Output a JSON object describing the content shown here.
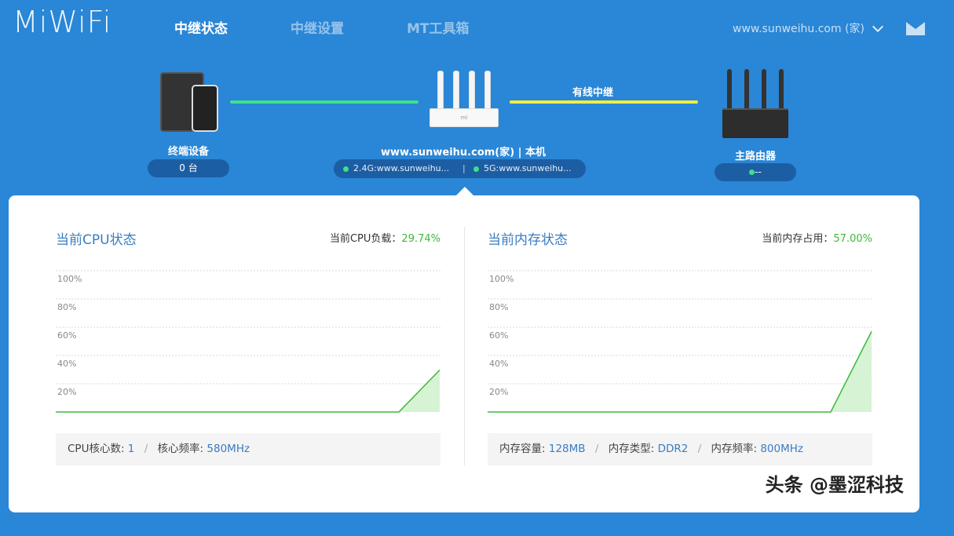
{
  "header": {
    "logo": "MiWiFi",
    "nav": [
      {
        "label": "中继状态",
        "active": true
      },
      {
        "label": "中继设置",
        "active": false
      },
      {
        "label": "MT工具箱",
        "active": false
      }
    ],
    "account": "www.sunweihu.com (家)"
  },
  "topology": {
    "devices_label": "终端设备",
    "devices_count": "0 台",
    "wired_label": "有线中继",
    "router_name": "www.sunweihu.com(家) | 本机",
    "ssid_24": "2.4G:www.sunweihu...",
    "ssid_5": "5G:www.sunweihu...",
    "ssid_sep": "|",
    "main_router_label": "主路由器",
    "main_router_status": "--",
    "router_mark": "mi"
  },
  "cpu": {
    "title": "当前CPU状态",
    "metric_label": "当前CPU负载：",
    "metric_value": "29.74%",
    "cores_label": "CPU核心数:",
    "cores_value": "1",
    "freq_label": "核心频率:",
    "freq_value": "580MHz"
  },
  "mem": {
    "title": "当前内存状态",
    "metric_label": "当前内存占用：",
    "metric_value": "57.00%",
    "cap_label": "内存容量:",
    "cap_value": "128MB",
    "type_label": "内存类型:",
    "type_value": "DDR2",
    "freq_label": "内存频率:",
    "freq_value": "800MHz"
  },
  "chart_data": [
    {
      "type": "area",
      "ylim": [
        0,
        100
      ],
      "yticks": [
        "20%",
        "40%",
        "60%",
        "80%",
        "100%"
      ],
      "x": [
        0,
        1,
        2,
        3,
        4,
        5,
        6,
        7,
        8,
        9,
        10,
        11
      ],
      "values": [
        0,
        0,
        0,
        0,
        0,
        0,
        0,
        0,
        0,
        0,
        0,
        29.74
      ],
      "grid": true
    },
    {
      "type": "area",
      "ylim": [
        0,
        100
      ],
      "yticks": [
        "20%",
        "40%",
        "60%",
        "80%",
        "100%"
      ],
      "x": [
        0,
        1,
        2,
        3,
        4,
        5,
        6,
        7,
        8,
        9,
        10,
        11
      ],
      "values": [
        0,
        0,
        0,
        0,
        0,
        0,
        0,
        0,
        0,
        0,
        0,
        57.0
      ],
      "grid": true
    }
  ],
  "watermark": "头条 @墨涩科技",
  "colors": {
    "background": "#2a86d6",
    "accent": "#3a7cc2",
    "ok": "#3db83d",
    "wired": "#f3ee3d",
    "wireless": "#3ee08a"
  }
}
